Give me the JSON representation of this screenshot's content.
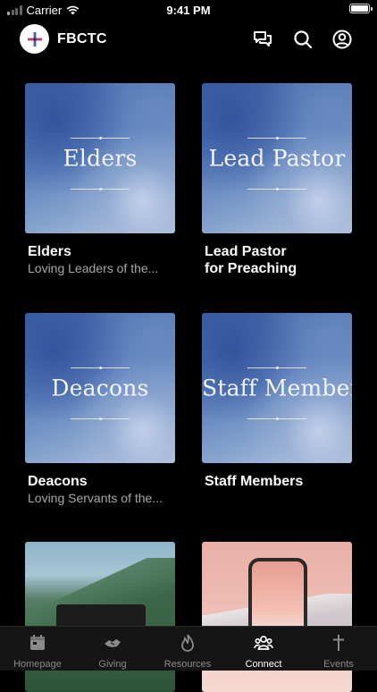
{
  "status_bar": {
    "carrier": "Carrier",
    "time": "9:41 PM"
  },
  "header": {
    "title": "FBCTC"
  },
  "cards": [
    {
      "thumb_title": "Elders",
      "title": "Elders",
      "subtitle": "Loving Leaders of the..."
    },
    {
      "thumb_title": "Lead Pastor",
      "title": "Lead Pastor\nfor Preaching",
      "subtitle": ""
    },
    {
      "thumb_title": "Deacons",
      "title": "Deacons",
      "subtitle": "Loving Servants of the..."
    },
    {
      "thumb_title": "Staff Members",
      "title": "Staff Members",
      "subtitle": ""
    }
  ],
  "tabs": [
    {
      "label": "Homepage",
      "icon": "calendar-icon"
    },
    {
      "label": "Giving",
      "icon": "handshake-icon"
    },
    {
      "label": "Resources",
      "icon": "flame-icon"
    },
    {
      "label": "Connect",
      "icon": "people-icon",
      "active": true
    },
    {
      "label": "Events",
      "icon": "cross-icon"
    }
  ],
  "colors": {
    "background": "#000000",
    "tabbar": "#151515",
    "inactive_tab": "#8a8a8a",
    "active_tab": "#ffffff"
  }
}
